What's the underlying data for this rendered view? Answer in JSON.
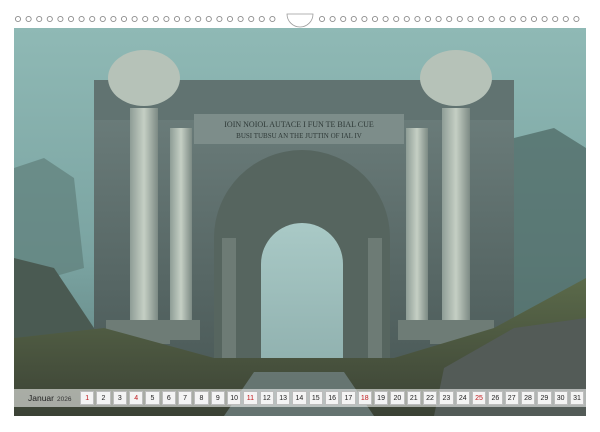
{
  "calendar": {
    "month": "Januar",
    "year": "2026",
    "days": [
      {
        "d": "1",
        "red": true
      },
      {
        "d": "2",
        "red": false
      },
      {
        "d": "3",
        "red": false
      },
      {
        "d": "4",
        "red": true
      },
      {
        "d": "5",
        "red": false
      },
      {
        "d": "6",
        "red": false
      },
      {
        "d": "7",
        "red": false
      },
      {
        "d": "8",
        "red": false
      },
      {
        "d": "9",
        "red": false
      },
      {
        "d": "10",
        "red": false
      },
      {
        "d": "11",
        "red": true
      },
      {
        "d": "12",
        "red": false
      },
      {
        "d": "13",
        "red": false
      },
      {
        "d": "14",
        "red": false
      },
      {
        "d": "15",
        "red": false
      },
      {
        "d": "16",
        "red": false
      },
      {
        "d": "17",
        "red": false
      },
      {
        "d": "18",
        "red": true
      },
      {
        "d": "19",
        "red": false
      },
      {
        "d": "20",
        "red": false
      },
      {
        "d": "21",
        "red": false
      },
      {
        "d": "22",
        "red": false
      },
      {
        "d": "23",
        "red": false
      },
      {
        "d": "24",
        "red": false
      },
      {
        "d": "25",
        "red": true
      },
      {
        "d": "26",
        "red": false
      },
      {
        "d": "27",
        "red": false
      },
      {
        "d": "28",
        "red": false
      },
      {
        "d": "29",
        "red": false
      },
      {
        "d": "30",
        "red": false
      },
      {
        "d": "31",
        "red": false
      }
    ]
  },
  "photo": {
    "inscription_line1": "IOIN NOIOL AUTACE I FUN TE BIAL CUE",
    "inscription_line2": "BUSI TUBSU AN THE JUTTIN OF IAL IV"
  },
  "colors": {
    "holiday": "#c0181c",
    "fog": "#7fa9a6",
    "stone": "#5f6f6c"
  }
}
